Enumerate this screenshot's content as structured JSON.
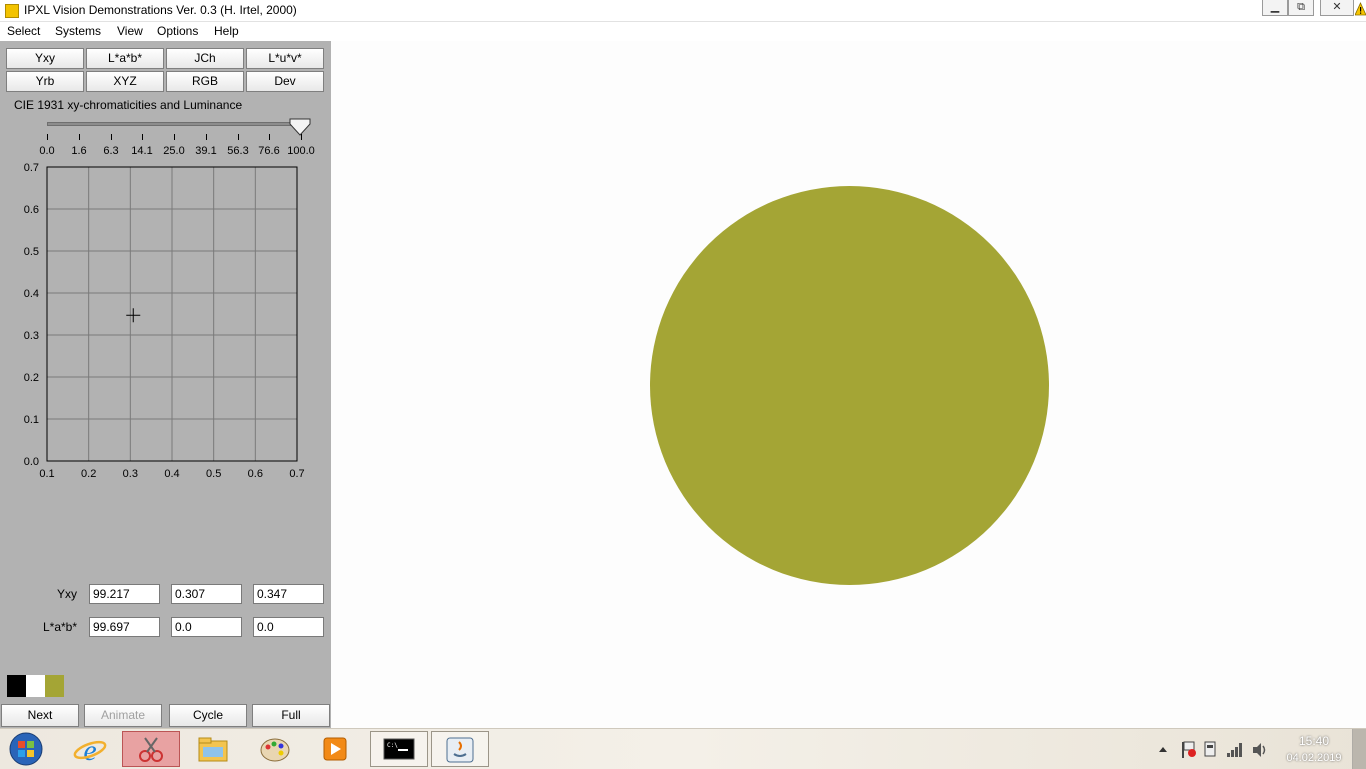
{
  "window": {
    "title": "IPXL Vision Demonstrations Ver. 0.3 (H. Irtel, 2000)",
    "controls": {
      "minimize": "▁",
      "restore": "⧉",
      "close": "✕"
    }
  },
  "menu": [
    "Select",
    "Systems",
    "View",
    "Options",
    "Help"
  ],
  "systems": [
    "Yxy",
    "L*a*b*",
    "JCh",
    "L*u*v*",
    "Yrb",
    "XYZ",
    "RGB",
    "Dev"
  ],
  "panel": {
    "title": "CIE 1931 xy-chromaticities and Luminance",
    "luminance_slider": {
      "labels": [
        "0.0",
        "1.6",
        "6.3",
        "14.1",
        "25.0",
        "39.1",
        "56.3",
        "76.6",
        "100.0"
      ],
      "value": 100.0
    },
    "plot": {
      "x_ticks": [
        "0.1",
        "0.2",
        "0.3",
        "0.4",
        "0.5",
        "0.6",
        "0.7"
      ],
      "y_ticks": [
        "0.0",
        "0.1",
        "0.2",
        "0.3",
        "0.4",
        "0.5",
        "0.6",
        "0.7"
      ],
      "marker": {
        "x": 0.307,
        "y": 0.347
      }
    },
    "fields": {
      "yxy_label": "Yxy",
      "yxy": [
        "99.217",
        "0.307",
        "0.347"
      ],
      "lab_label": "L*a*b*",
      "lab": [
        "99.697",
        "0.0",
        "0.0"
      ]
    },
    "swatches": [
      "#000000",
      "#ffffff",
      "#a4a535"
    ],
    "buttons": {
      "next": "Next",
      "animate": "Animate",
      "cycle": "Cycle",
      "full": "Full"
    }
  },
  "display": {
    "stimulus_color": "#a4a535"
  },
  "taskbar": {
    "apps": [
      "windows-start",
      "internet-explorer",
      "snipping-tool",
      "file-explorer",
      "paint",
      "media-player",
      "command-prompt",
      "java"
    ],
    "clock_time": "15:40",
    "clock_date": "04.02.2019"
  }
}
